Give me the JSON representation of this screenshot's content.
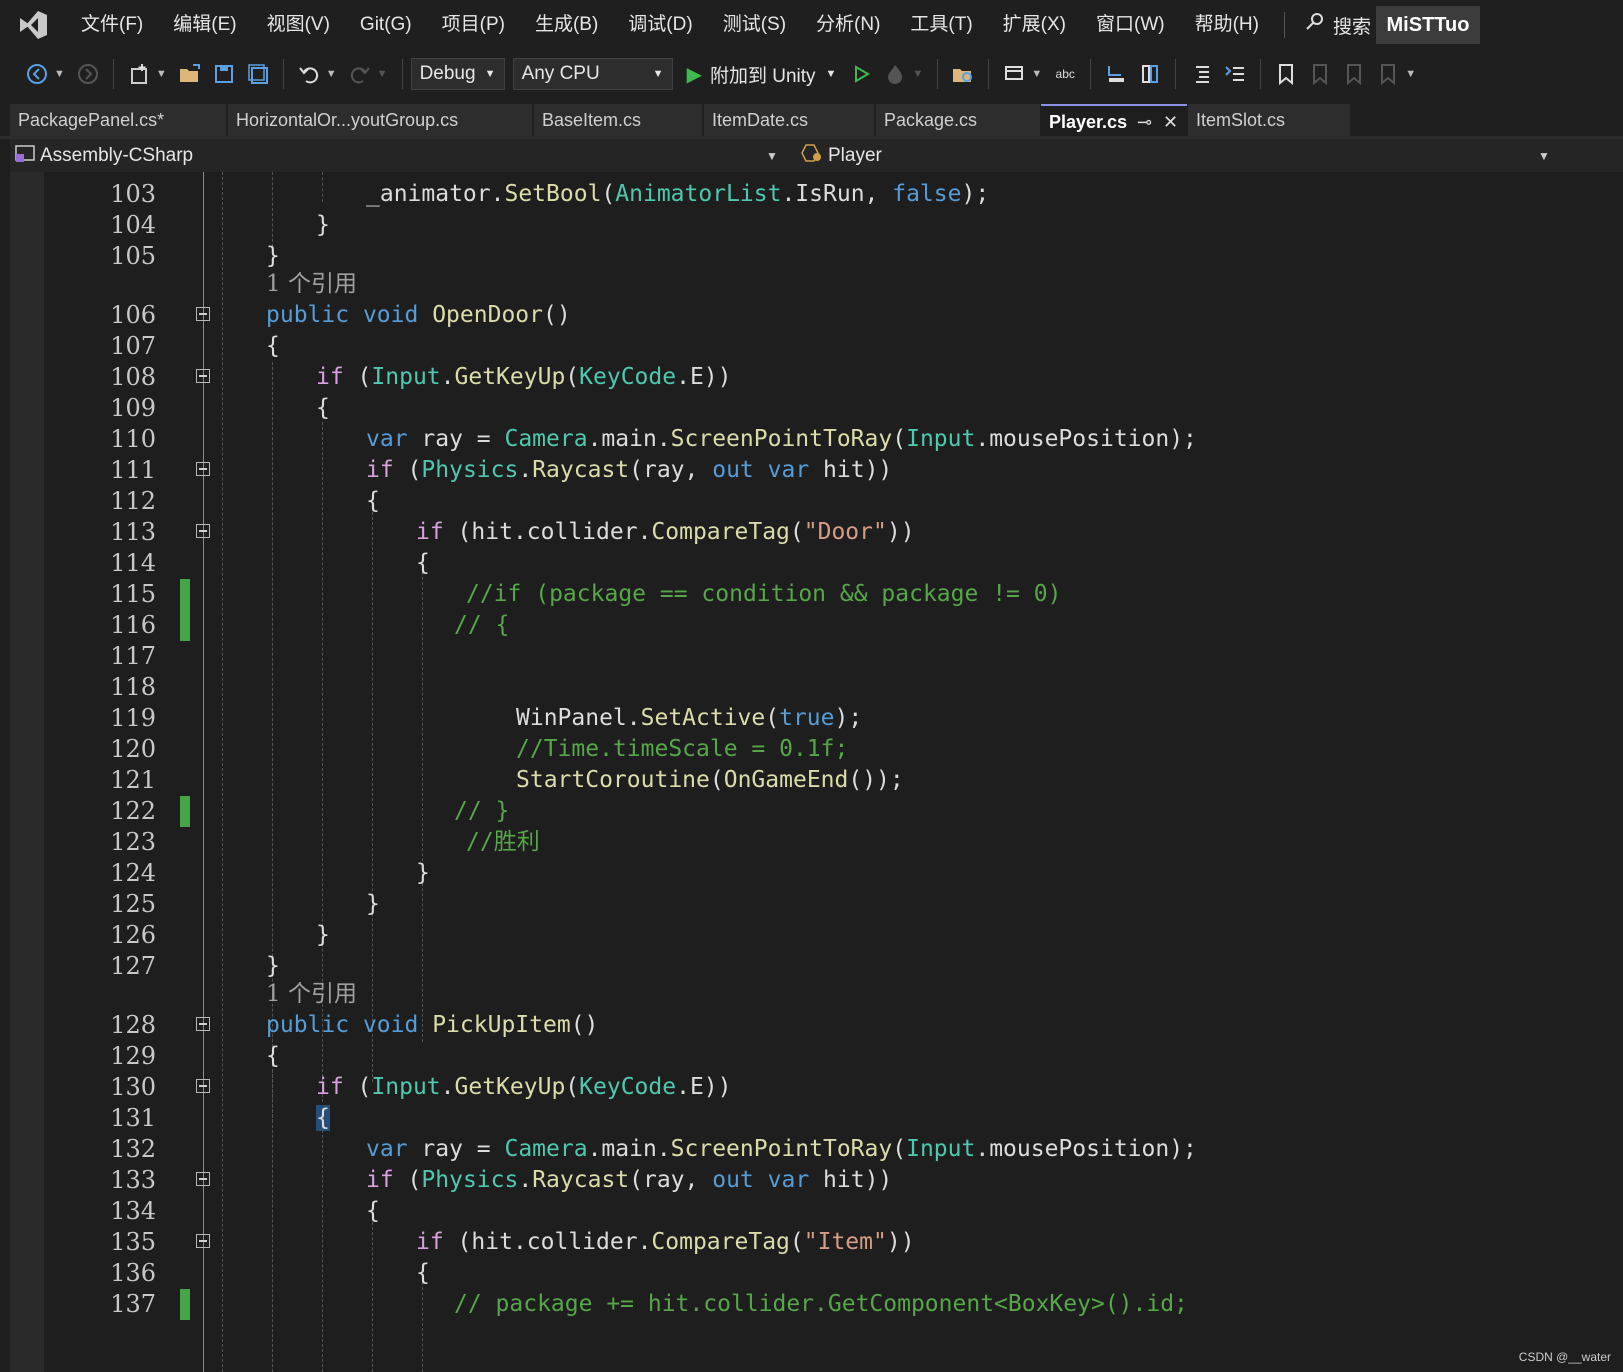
{
  "menubar": {
    "items": [
      "文件(F)",
      "编辑(E)",
      "视图(V)",
      "Git(G)",
      "项目(P)",
      "生成(B)",
      "调试(D)",
      "测试(S)",
      "分析(N)",
      "工具(T)",
      "扩展(X)",
      "窗口(W)",
      "帮助(H)"
    ],
    "search_label": "搜索",
    "profile_label": "MiSTTuo"
  },
  "toolbar": {
    "config": "Debug",
    "platform": "Any CPU",
    "attach_label": "附加到 Unity"
  },
  "tabs": [
    {
      "label": "PackagePanel.cs*"
    },
    {
      "label": "HorizontalOr...youtGroup.cs"
    },
    {
      "label": "BaseItem.cs"
    },
    {
      "label": "ItemDate.cs"
    },
    {
      "label": "Package.cs"
    },
    {
      "label": "Player.cs"
    },
    {
      "label": "ItemSlot.cs"
    }
  ],
  "navbar": {
    "project": "Assembly-CSharp",
    "class": "Player"
  },
  "editor": {
    "ref_count": "1 个引用",
    "line_numbers": [
      "103",
      "104",
      "105",
      "106",
      "107",
      "108",
      "109",
      "110",
      "111",
      "112",
      "113",
      "114",
      "115",
      "116",
      "117",
      "118",
      "119",
      "120",
      "121",
      "122",
      "123",
      "124",
      "125",
      "126",
      "127",
      "128",
      "129",
      "130",
      "131",
      "132",
      "133",
      "134",
      "135",
      "136",
      "137"
    ]
  },
  "watermark": "CSDN @__water",
  "colors": {
    "background": "#1e1e1e",
    "keyword": "#569cd6",
    "control": "#d8a0df",
    "type": "#4ec9b0",
    "method": "#dcdcaa",
    "string": "#d69d85",
    "comment": "#57a64a",
    "change_marker": "#46a546"
  }
}
